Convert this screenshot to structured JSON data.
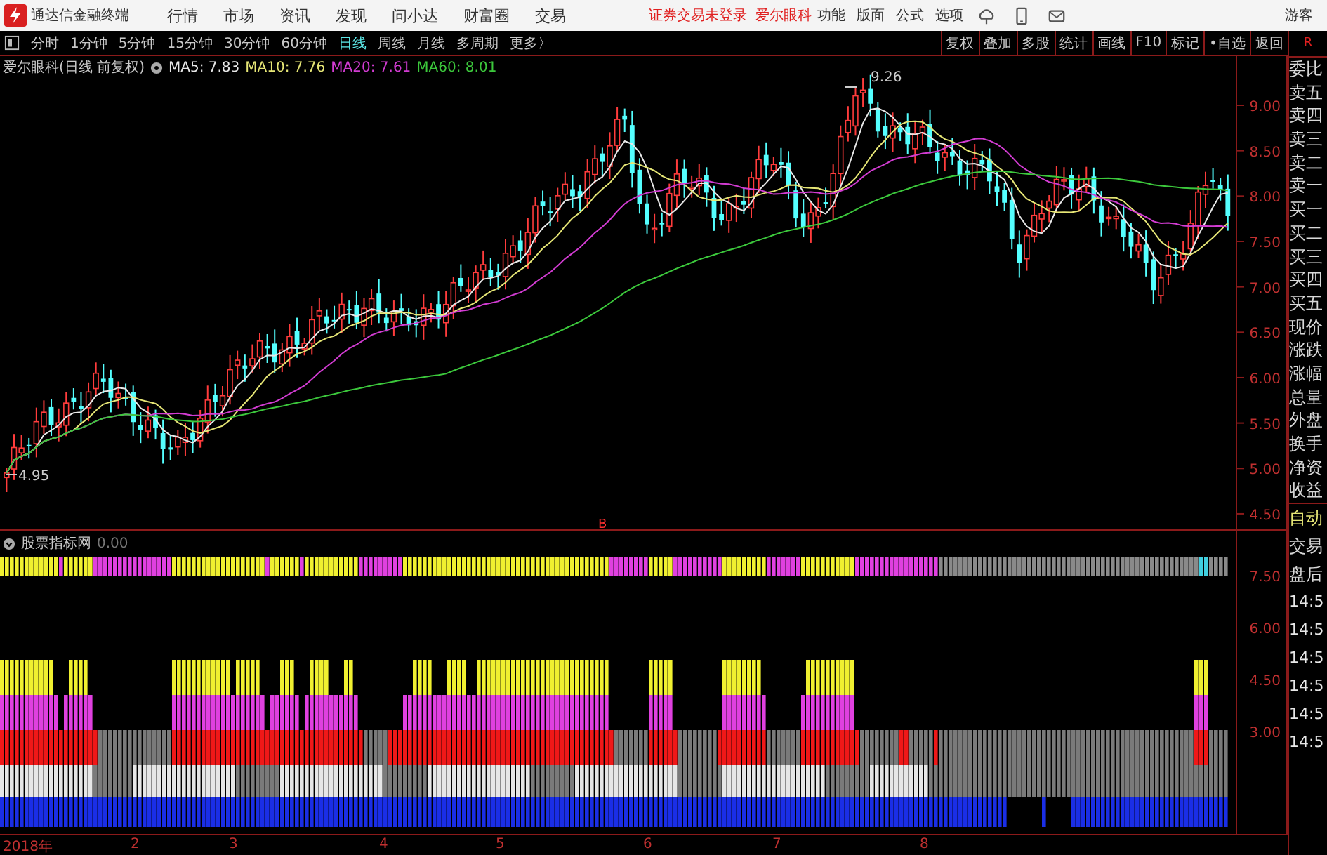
{
  "app": {
    "name": "通达信金融终端",
    "menu": [
      "行情",
      "市场",
      "资讯",
      "发现",
      "问小达",
      "财富圈",
      "交易"
    ],
    "status": "证券交易未登录",
    "stock": "爱尔眼科",
    "tools": [
      "功能",
      "版面",
      "公式",
      "选项"
    ],
    "user": "游客"
  },
  "periods": [
    {
      "label": "分时",
      "selected": false
    },
    {
      "label": "1分钟",
      "selected": false
    },
    {
      "label": "5分钟",
      "selected": false
    },
    {
      "label": "15分钟",
      "selected": false
    },
    {
      "label": "30分钟",
      "selected": false
    },
    {
      "label": "60分钟",
      "selected": false
    },
    {
      "label": "日线",
      "selected": true
    },
    {
      "label": "周线",
      "selected": false
    },
    {
      "label": "月线",
      "selected": false
    },
    {
      "label": "多周期",
      "selected": false
    },
    {
      "label": "更多〉",
      "selected": false
    }
  ],
  "actions": [
    "复权",
    "叠加",
    "多股",
    "统计",
    "画线",
    "F10",
    "标记",
    "•自选",
    "返回"
  ],
  "chart": {
    "title": "爱尔眼科(日线 前复权)",
    "ma": [
      {
        "label": "MA5: 7.83",
        "color": "#e8e8e8"
      },
      {
        "label": "MA10: 7.76",
        "color": "#e6e676"
      },
      {
        "label": "MA20: 7.61",
        "color": "#d23cd2"
      },
      {
        "label": "MA60: 8.01",
        "color": "#3cc83c"
      }
    ],
    "high_label": "9.26",
    "low_label": "4.95",
    "marker": "B",
    "y_labels": [
      "9.00",
      "8.50",
      "8.00",
      "7.50",
      "7.00",
      "6.50",
      "6.00",
      "5.50",
      "5.00",
      "4.50"
    ]
  },
  "indicator": {
    "title": "股票指标网",
    "value": "0.00",
    "y_labels": [
      "7.50",
      "6.00",
      "4.50",
      "3.00"
    ]
  },
  "x_labels": [
    "2018年",
    "2",
    "3",
    "4",
    "5",
    "6",
    "7",
    "8"
  ],
  "quote_panel": {
    "header": "R",
    "labels": [
      "委比",
      "卖五",
      "卖四",
      "卖三",
      "卖二",
      "卖一",
      "买一",
      "买二",
      "买三",
      "买四",
      "买五",
      "现价",
      "涨跌",
      "涨幅",
      "总量",
      "外盘",
      "换手",
      "净资",
      "收益"
    ],
    "trade_labels": [
      "自动",
      "交易",
      "盘后"
    ],
    "times": [
      "14:5",
      "14:5",
      "14:5",
      "14:5",
      "14:5",
      "14:5"
    ]
  }
}
